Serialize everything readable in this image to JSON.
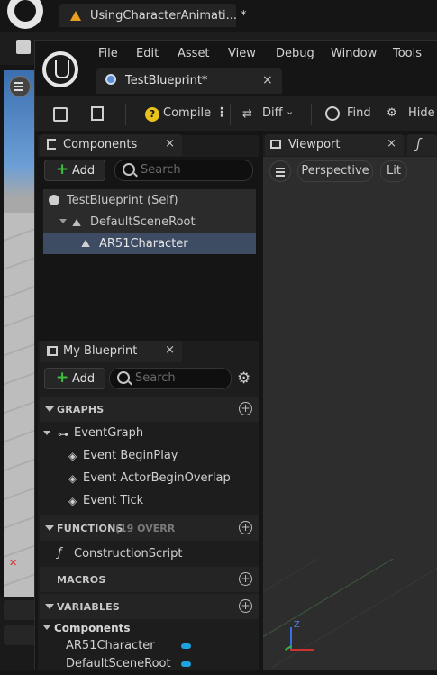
{
  "background_editor": {
    "tab_title": "UsingCharacterAnimati... *"
  },
  "menu": {
    "items": [
      "File",
      "Edit",
      "Asset",
      "View",
      "Debug",
      "Window",
      "Tools"
    ]
  },
  "document_tab": {
    "title": "TestBlueprint*",
    "close": "×"
  },
  "toolbar": {
    "compile_label": "Compile",
    "diff_label": "Diff",
    "find_label": "Find",
    "hide_label": "Hide U"
  },
  "components_panel": {
    "title": "Components",
    "close": "×",
    "add_label": "Add",
    "search_placeholder": "Search",
    "tree": [
      {
        "label": "TestBlueprint (Self)"
      },
      {
        "label": "DefaultSceneRoot"
      },
      {
        "label": "AR51Character"
      }
    ]
  },
  "viewport_panel": {
    "title": "Viewport",
    "close": "×",
    "second_tab_glyph": "ƒ",
    "perspective_label": "Perspective",
    "lit_label": "Lit",
    "axis_z": "Z"
  },
  "my_blueprint": {
    "title": "My Blueprint",
    "close": "×",
    "add_label": "Add",
    "search_placeholder": "Search",
    "graphs_header": "GRAPHS",
    "event_graph": "EventGraph",
    "events": [
      "Event BeginPlay",
      "Event ActorBeginOverlap",
      "Event Tick"
    ],
    "functions_header": "FUNCTIONS",
    "functions_note": "(19 OVERR",
    "construction_script": "ConstructionScript",
    "macros_header": "MACROS",
    "variables_header": "VARIABLES",
    "components_group": "Components",
    "variables": [
      "AR51Character",
      "DefaultSceneRoot"
    ],
    "variable_color": "#1fa3e0"
  },
  "colors": {
    "accent_orange": "#e8a020",
    "add_green": "#3dbf3d",
    "selection": "#3d4c63"
  }
}
